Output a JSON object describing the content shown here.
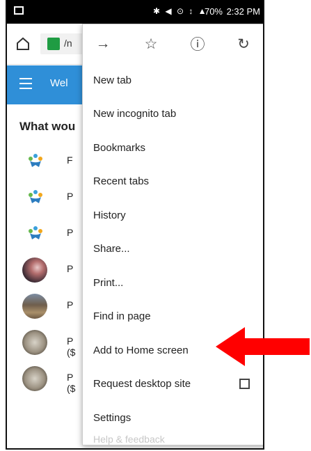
{
  "status_bar": {
    "battery": "70%",
    "time": "2:32 PM"
  },
  "browser": {
    "url_text": "/n"
  },
  "page": {
    "header_title": "Wel",
    "question": "What wou",
    "list_items": [
      {
        "label": "F",
        "sublabel": ""
      },
      {
        "label": "P",
        "sublabel": ""
      },
      {
        "label": "P",
        "sublabel": ""
      },
      {
        "label": "P",
        "sublabel": ""
      },
      {
        "label": "P",
        "sublabel": ""
      },
      {
        "label": "P",
        "sublabel": "($"
      },
      {
        "label": "P",
        "sublabel": "($"
      }
    ]
  },
  "menu": {
    "items": [
      {
        "label": "New tab"
      },
      {
        "label": "New incognito tab"
      },
      {
        "label": "Bookmarks"
      },
      {
        "label": "Recent tabs"
      },
      {
        "label": "History"
      },
      {
        "label": "Share..."
      },
      {
        "label": "Print..."
      },
      {
        "label": "Find in page"
      },
      {
        "label": "Add to Home screen"
      },
      {
        "label": "Request desktop site"
      },
      {
        "label": "Settings"
      }
    ],
    "faded_item": "Help & feedback"
  },
  "colors": {
    "header_blue": "#2f8fd8",
    "arrow_red": "#ff0000",
    "lock_green": "#1f9c43"
  }
}
